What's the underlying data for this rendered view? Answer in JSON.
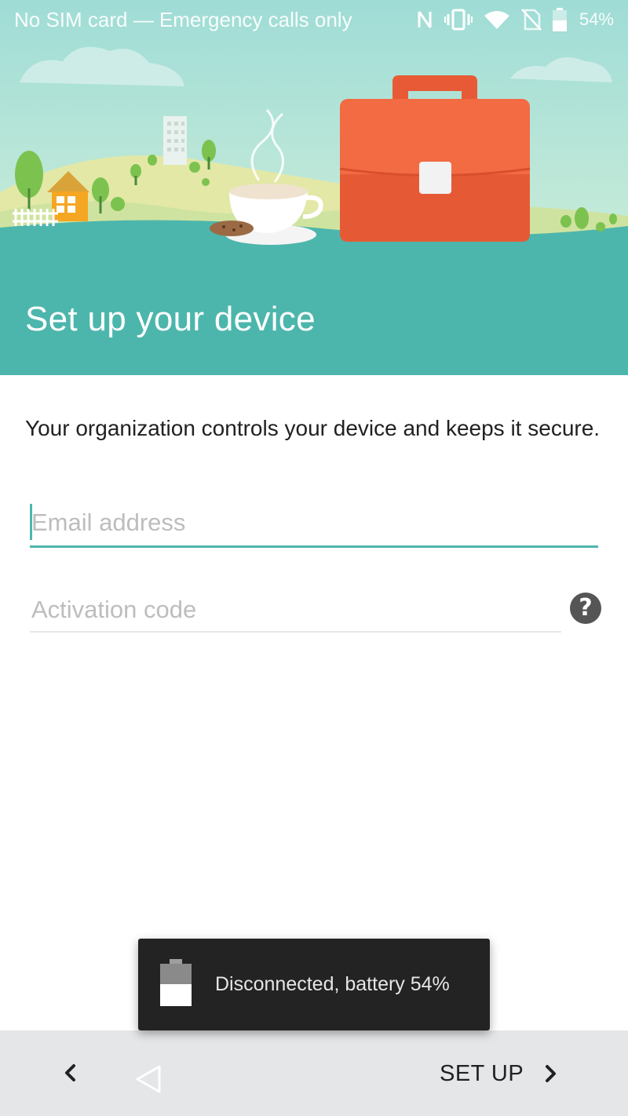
{
  "status_bar": {
    "carrier_text": "No SIM card — Emergency calls only",
    "battery_percent": "54%",
    "icons": [
      "nfc-icon",
      "vibrate-icon",
      "wifi-icon",
      "no-sim-icon",
      "battery-icon"
    ]
  },
  "hero": {
    "title": "Set up your device"
  },
  "main": {
    "description": "Your organization controls your device and keeps it secure.",
    "email_field": {
      "placeholder": "Email address",
      "value": ""
    },
    "activation_field": {
      "placeholder": "Activation code",
      "value": ""
    },
    "help_icon_glyph": "?"
  },
  "toast": {
    "message": "Disconnected, battery 54%"
  },
  "bottom_bar": {
    "setup_label": "SET UP"
  },
  "colors": {
    "accent": "#4db6ac",
    "briefcase": "#f26b43",
    "toast_bg": "#232323",
    "bottom_bar_bg": "#e4e6e8"
  }
}
